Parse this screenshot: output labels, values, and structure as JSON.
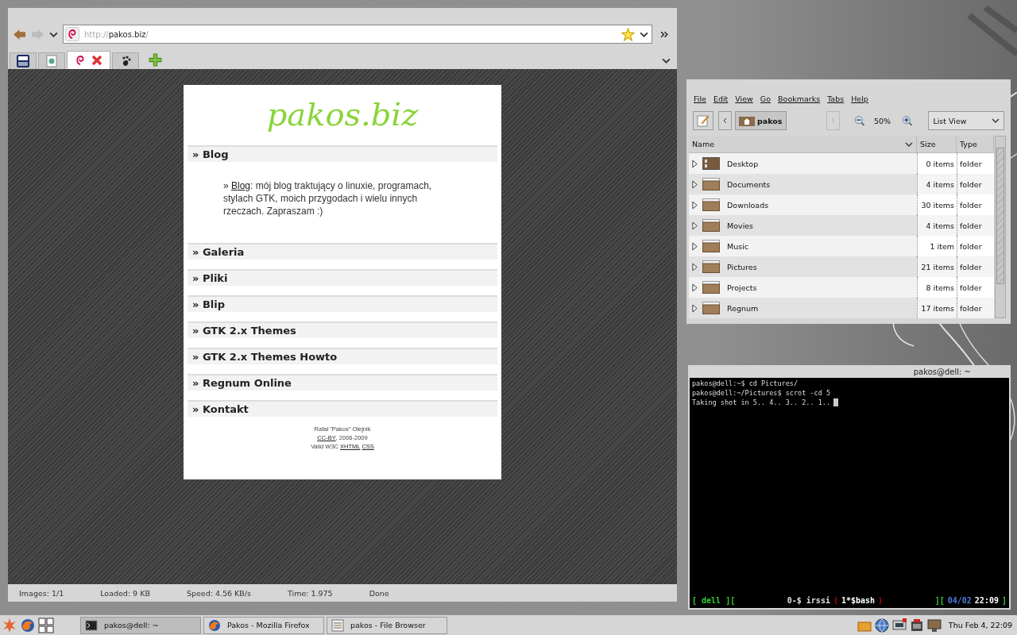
{
  "browser": {
    "url": {
      "scheme": "http://",
      "host": "pakos.biz",
      "path": "/"
    },
    "tabs": [
      {
        "kind": "dzjsp",
        "selected": false
      },
      {
        "kind": "page",
        "selected": false
      },
      {
        "kind": "debian",
        "selected": true
      },
      {
        "kind": "paw",
        "selected": false
      }
    ],
    "page": {
      "logo": "pakos.biz",
      "sections": [
        {
          "title": "» Blog",
          "intro": {
            "prefix": "» ",
            "link": "Blog",
            "text": ": mój blog traktujący o linuxie, programach, stylach GTK, moich przygodach i wielu innych rzeczach. Zapraszam :)"
          }
        },
        {
          "title": "» Galeria"
        },
        {
          "title": "» Pliki"
        },
        {
          "title": "» Blip"
        },
        {
          "title": "» GTK 2.x Themes"
        },
        {
          "title": "» GTK 2.x Themes Howto"
        },
        {
          "title": "» Regnum Online"
        },
        {
          "title": "» Kontakt"
        }
      ],
      "footer": {
        "author": "Rafał \"Pakos\" Olejnik",
        "license_link": "CC-BY",
        "years": ", 2006-2009",
        "valid": "Valid W3C",
        "links": [
          "XHTML",
          "CSS"
        ]
      }
    },
    "status_bar": [
      "Images: 1/1",
      "Loaded: 9 KB",
      "Speed: 4.56 KB/s",
      "Time: 1.975",
      "Done"
    ]
  },
  "file_browser": {
    "menu": [
      "File",
      "Edit",
      "View",
      "Go",
      "Bookmarks",
      "Tabs",
      "Help"
    ],
    "location": "pakos",
    "zoom": "50%",
    "view": "List View",
    "columns": [
      "Name",
      "Size",
      "Type"
    ],
    "rows": [
      {
        "kind": "desktop",
        "name": "Desktop",
        "size": "0 items",
        "type": "folder"
      },
      {
        "kind": "folder",
        "name": "Documents",
        "size": "4 items",
        "type": "folder"
      },
      {
        "kind": "folder",
        "name": "Downloads",
        "size": "30 items",
        "type": "folder"
      },
      {
        "kind": "folder",
        "name": "Movies",
        "size": "4 items",
        "type": "folder"
      },
      {
        "kind": "folder",
        "name": "Music",
        "size": "1 item",
        "type": "folder"
      },
      {
        "kind": "folder",
        "name": "Pictures",
        "size": "21 items",
        "type": "folder"
      },
      {
        "kind": "folder",
        "name": "Projects",
        "size": "8 items",
        "type": "folder"
      },
      {
        "kind": "folder",
        "name": "Regnum",
        "size": "17 items",
        "type": "folder"
      }
    ]
  },
  "terminal": {
    "title": "pakos@dell: ~",
    "lines": [
      "pakos@dell:~$ cd Pictures/",
      "pakos@dell:~/Pictures$ scrot -cd 5",
      "Taking shot in 5.. 4.. 3.. 2.. 1.."
    ],
    "status_left": [
      {
        "text": "[ dell ][",
        "color": "#33cc33"
      }
    ],
    "status_mid": [
      {
        "text": "0-$ irssi",
        "color": "#e0e0e0"
      },
      {
        "text": "(",
        "color": "#cc0000"
      },
      {
        "text": "1*$bash",
        "color": "#ffffff"
      },
      {
        "text": ")",
        "color": "#cc0000"
      }
    ],
    "status_right": [
      {
        "text": "][",
        "color": "#33cc33"
      },
      {
        "text": "04/02",
        "color": "#5577dd"
      },
      {
        "text": "22:09",
        "color": "#ffffff"
      },
      {
        "text": "]",
        "color": "#33cc33"
      }
    ]
  },
  "taskbar": {
    "tasks": [
      {
        "kind": "terminal",
        "label": "pakos@dell: ~",
        "selected": true
      },
      {
        "kind": "firefox",
        "label": "Pakos - Mozilla Firefox",
        "selected": false
      },
      {
        "kind": "files",
        "label": "pakos - File Browser",
        "selected": false
      }
    ],
    "clock": "Thu Feb  4, 22:09"
  }
}
